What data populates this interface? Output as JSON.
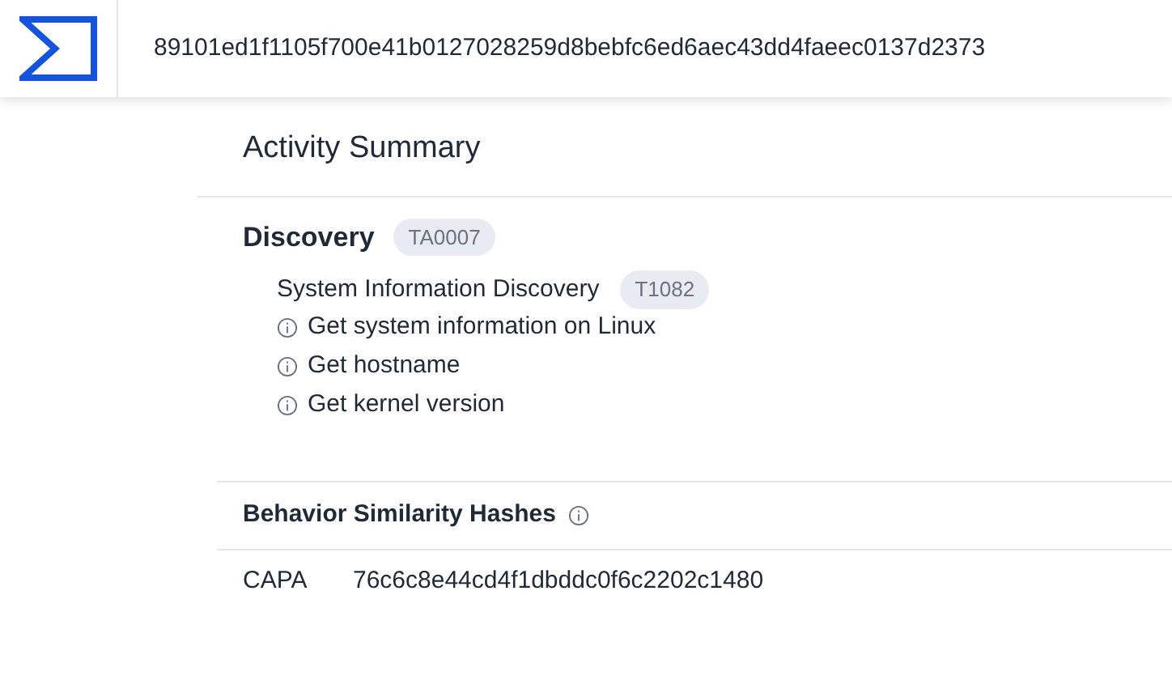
{
  "header": {
    "hash": "89101ed1f1105f700e41b0127028259d8bebfc6ed6aec43dd4faeec0137d2373"
  },
  "activity_summary": {
    "title": "Activity Summary",
    "tactics": [
      {
        "name": "Discovery",
        "id": "TA0007",
        "techniques": [
          {
            "name": "System Information Discovery",
            "id": "T1082",
            "behaviors": [
              "Get system information on Linux",
              "Get hostname",
              "Get kernel version"
            ]
          }
        ]
      }
    ]
  },
  "similarity": {
    "title": "Behavior Similarity Hashes",
    "rows": [
      {
        "label": "CAPA",
        "value": "76c6c8e44cd4f1dbddc0f6c2202c1480"
      }
    ]
  }
}
